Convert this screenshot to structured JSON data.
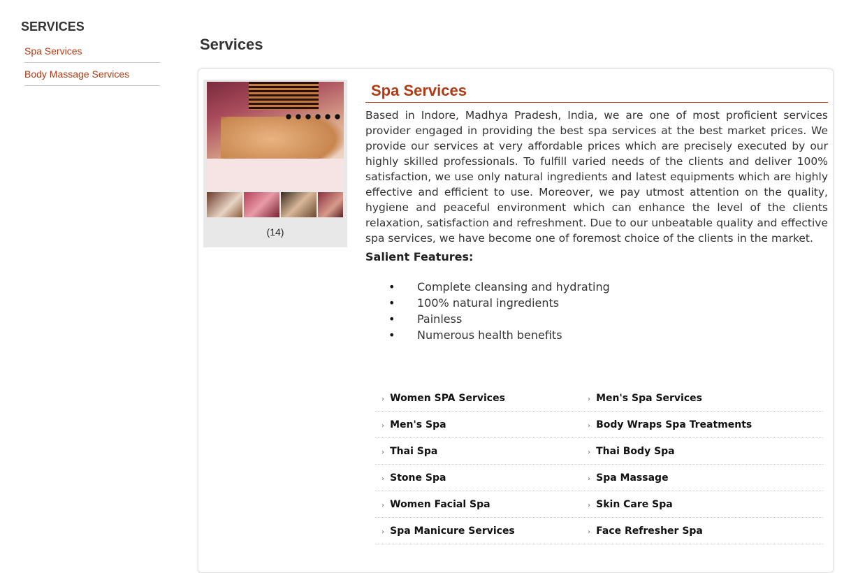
{
  "sidebar": {
    "heading": "SERVICES",
    "items": [
      {
        "label": "Spa Services"
      },
      {
        "label": "Body Massage Services"
      }
    ]
  },
  "page_title": "Services",
  "product": {
    "title": "Spa Services",
    "photo_count": "(14)",
    "description": "Based in Indore, Madhya Pradesh, India, we are one of most proficient services provider engaged in providing the best spa services at the best market prices. We provide our services at very affordable prices which are precisely executed by our highly skilled professionals. To fulfill varied needs of the clients and deliver 100% satisfaction, we use only natural ingredients and latest equipments which are highly effective and efficient to use. Moreover, we pay utmost attention on the quality, hygiene and peaceful environment which can enhance the level of the clients relaxation, satisfaction and refreshment. Due to our unbeatable quality and effective spa services, we have become one of foremost choice of the clients in the market.",
    "features_title": "Salient Features:",
    "features": [
      "Complete cleansing and hydrating",
      "100% natural ingredients",
      "Painless",
      "Numerous health benefits"
    ]
  },
  "links": [
    "Women SPA Services",
    "Men's Spa Services",
    "Men's Spa",
    "Body Wraps Spa Treatments",
    "Thai Spa",
    "Thai Body Spa",
    "Stone Spa",
    "Spa Massage",
    "Women Facial Spa",
    "Skin Care Spa",
    "Spa Manicure Services",
    "Face Refresher Spa"
  ],
  "colors": {
    "accent": "#b23a12"
  }
}
